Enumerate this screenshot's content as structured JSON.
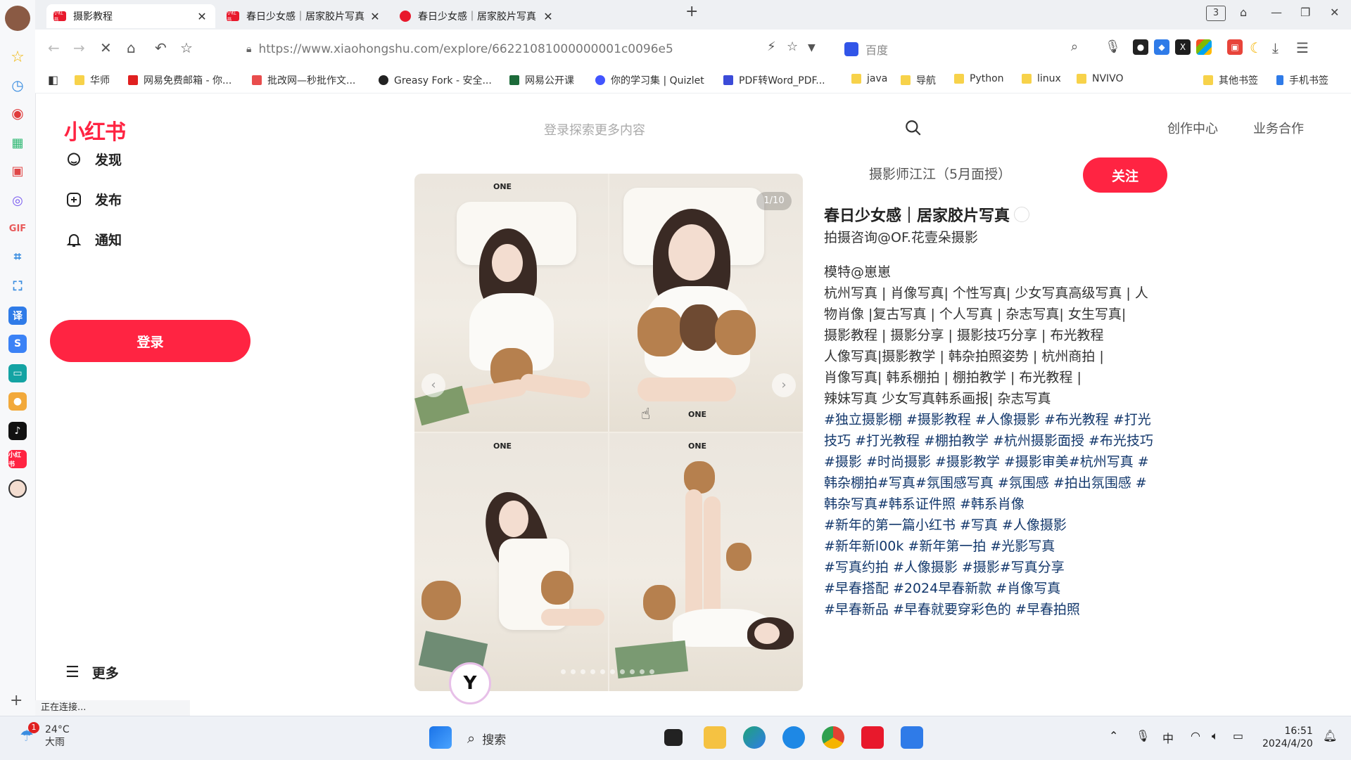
{
  "browser": {
    "tabs": [
      {
        "title": "摄影教程",
        "favicon": "xiaohongshu-favicon",
        "active": true
      },
      {
        "title": "春日少女感｜居家胶片写真",
        "favicon": "xiaohongshu-favicon",
        "active": false
      },
      {
        "title": "春日少女感｜居家胶片写真",
        "favicon": "chrome-favicon",
        "active": false
      }
    ],
    "tab_count_badge": "3",
    "url": "https://www.xiaohongshu.com/explore/66221081000000001c0096e5",
    "search_engine": "百度",
    "bookmarks": [
      "华师",
      "网易免费邮箱 - 你...",
      "批改网—秒批作文...",
      "Greasy Fork - 安全...",
      "网易公开课",
      "你的学习集 | Quizlet",
      "PDF转Word_PDF...",
      "java",
      "导航",
      "Python",
      "linux",
      "NVIVO"
    ],
    "bookmarks_right": [
      "其他书签",
      "手机书签"
    ],
    "status_text": "正在连接..."
  },
  "site": {
    "logo": "小红书",
    "search_placeholder": "登录探索更多内容",
    "top_links": [
      "创作中心",
      "业务合作"
    ],
    "sidebar": {
      "items": [
        {
          "label": "发现",
          "icon": "discover-icon"
        },
        {
          "label": "发布",
          "icon": "publish-icon"
        },
        {
          "label": "通知",
          "icon": "bell-icon"
        }
      ],
      "login": "登录",
      "more": "更多"
    }
  },
  "note": {
    "image_counter": "1/10",
    "image_brand": "ONE",
    "author": "摄影师江江（5月面授）",
    "follow": "关注",
    "title": "春日少女感｜居家胶片写真",
    "lines": [
      {
        "text": "拍摄咨询@OF.花壹朵摄影",
        "style": "normal"
      },
      {
        "text": "",
        "style": "gap"
      },
      {
        "text": "模特@崽崽",
        "style": "normal"
      },
      {
        "text": "杭州写真 | 肖像写真| 个性写真| 少女写真高级写真 | 人",
        "style": "normal"
      },
      {
        "text": "物肖像 |复古写真 | 个人写真 | 杂志写真| 女生写真|",
        "style": "normal"
      },
      {
        "text": "摄影教程 | 摄影分享 | 摄影技巧分享 | 布光教程",
        "style": "normal"
      },
      {
        "text": "人像写真|摄影教学 | 韩杂拍照姿势 | 杭州商拍 |",
        "style": "normal"
      },
      {
        "text": "肖像写真| 韩系棚拍 | 棚拍教学 | 布光教程 |",
        "style": "normal"
      },
      {
        "text": "辣妹写真 少女写真韩系画报| 杂志写真",
        "style": "normal"
      },
      {
        "text": "#独立摄影棚 #摄影教程 #人像摄影 #布光教程 #打光",
        "style": "tag"
      },
      {
        "text": "技巧 #打光教程 #棚拍教学 #杭州摄影面授 #布光技巧",
        "style": "tag"
      },
      {
        "text": "#摄影 #时尚摄影 #摄影教学 #摄影审美#杭州写真 #",
        "style": "tag"
      },
      {
        "text": "韩杂棚拍#写真#氛围感写真 #氛围感 #拍出氛围感 #",
        "style": "tag"
      },
      {
        "text": "韩杂写真#韩系证件照 #韩系肖像",
        "style": "tag"
      },
      {
        "text": "#新年的第一篇小红书 #写真 #人像摄影",
        "style": "tag"
      },
      {
        "text": "#新年新l00k #新年第一拍 #光影写真",
        "style": "tag"
      },
      {
        "text": "#写真约拍 #人像摄影 #摄影#写真分享",
        "style": "tag"
      },
      {
        "text": "#早春搭配 #2024早春新款 #肖像写真",
        "style": "tag"
      },
      {
        "text": "#早春新品 #早春就要穿彩色的 #早春拍照",
        "style": "tag"
      }
    ]
  },
  "taskbar": {
    "weather_temp": "24°C",
    "weather_desc": "大雨",
    "weather_badge": "1",
    "search_label": "搜索",
    "ime": "中",
    "time": "16:51",
    "date": "2024/4/20"
  },
  "colors": {
    "brand_red": "#ff2442",
    "tag_blue": "#13386c"
  }
}
